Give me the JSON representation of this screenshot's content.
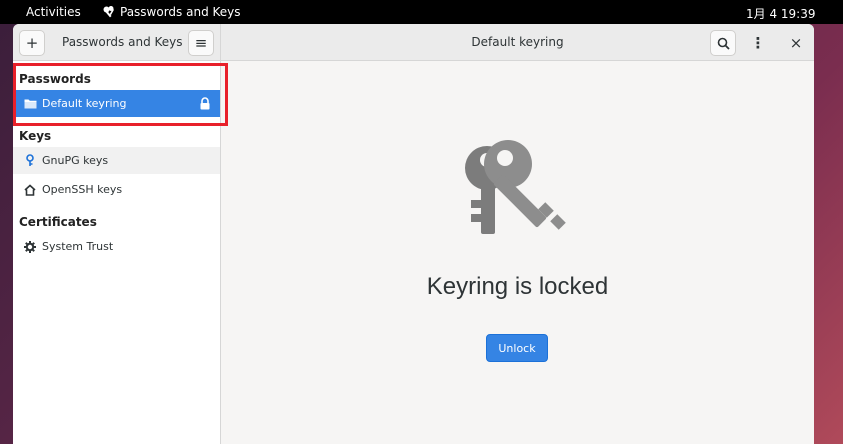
{
  "topbar": {
    "activities": "Activities",
    "app_name": "Passwords and Keys",
    "clock": "1月 4  19:39"
  },
  "window": {
    "sidebar_title": "Passwords and Keys",
    "main_title": "Default keyring",
    "buttons": {
      "add": "+",
      "menu": "≡",
      "more": "⋮",
      "close": "×"
    }
  },
  "sidebar": {
    "sections": [
      {
        "title": "Passwords",
        "items": [
          {
            "label": "Default keyring",
            "selected": true,
            "locked": true
          }
        ]
      },
      {
        "title": "Keys",
        "items": [
          {
            "label": "GnuPG keys"
          },
          {
            "label": "OpenSSH keys"
          }
        ]
      },
      {
        "title": "Certificates",
        "items": [
          {
            "label": "System Trust"
          }
        ]
      }
    ]
  },
  "content": {
    "status": "Keyring is locked",
    "unlock_label": "Unlock"
  },
  "colors": {
    "accent": "#3584e4",
    "highlight": "#e8202a"
  },
  "icons": [
    "keys-icon",
    "add-icon",
    "hamburger-menu-icon",
    "search-icon",
    "more-vertical-icon",
    "close-icon",
    "folder-icon",
    "lock-icon",
    "gnupg-key-icon",
    "home-icon",
    "gear-icon"
  ]
}
